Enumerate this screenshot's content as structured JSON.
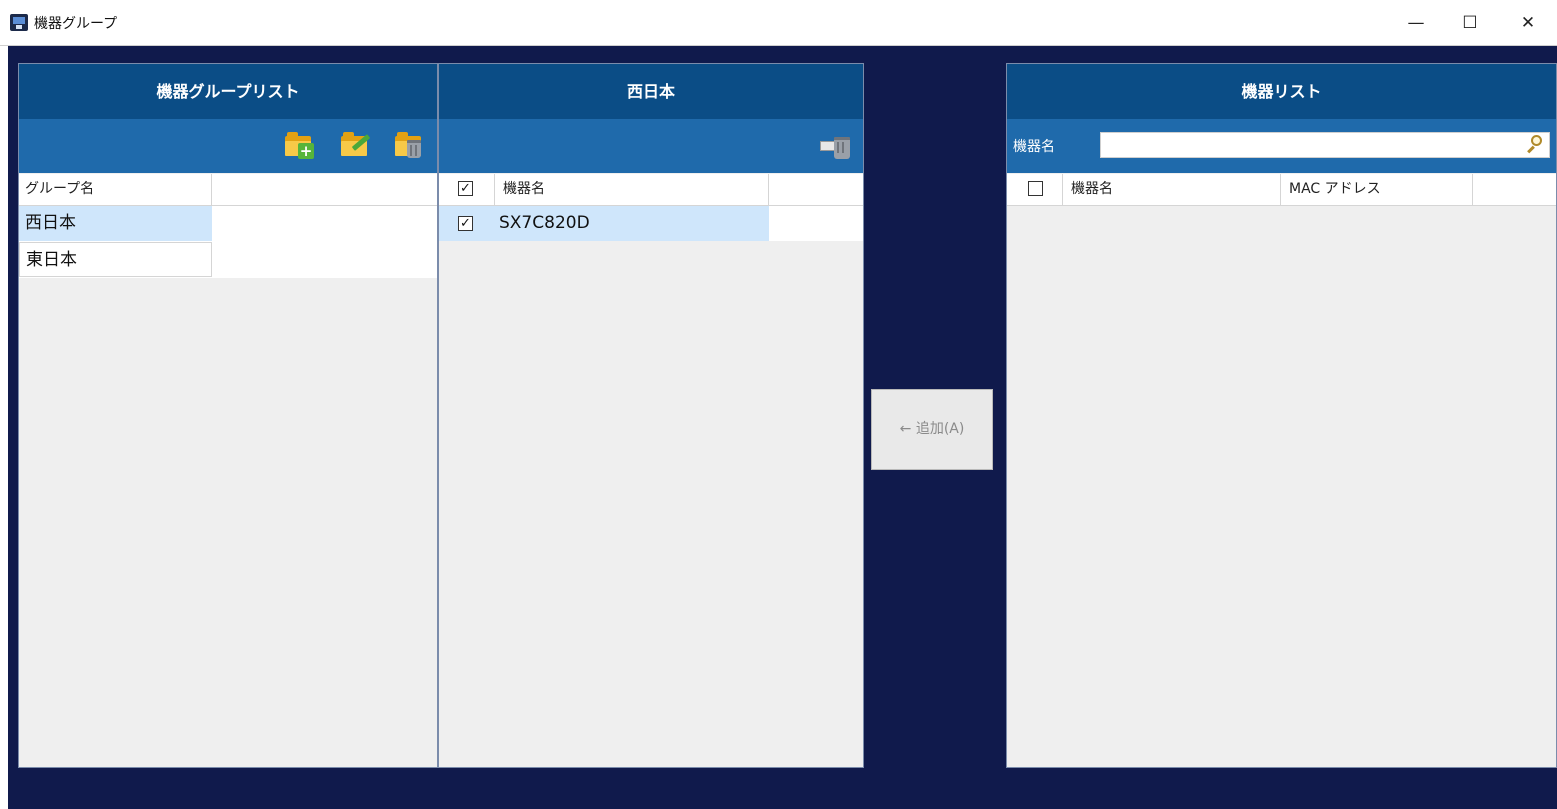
{
  "window": {
    "title": "機器グループ",
    "minimize": "—",
    "maximize": "☐",
    "close": "✕"
  },
  "group_panel": {
    "title": "機器グループリスト",
    "column_header": "グループ名",
    "groups": [
      "西日本",
      "東日本"
    ],
    "selected_index": 0
  },
  "members_panel": {
    "title": "西日本",
    "header_checked": true,
    "column_header": "機器名",
    "devices": [
      {
        "name": "SX7C820D",
        "checked": true
      }
    ]
  },
  "add_button": {
    "label": "← 追加(A)"
  },
  "device_panel": {
    "title": "機器リスト",
    "search_label": "機器名",
    "search_value": "",
    "header_checked": false,
    "column_name": "機器名",
    "column_mac": "MAC アドレス"
  }
}
